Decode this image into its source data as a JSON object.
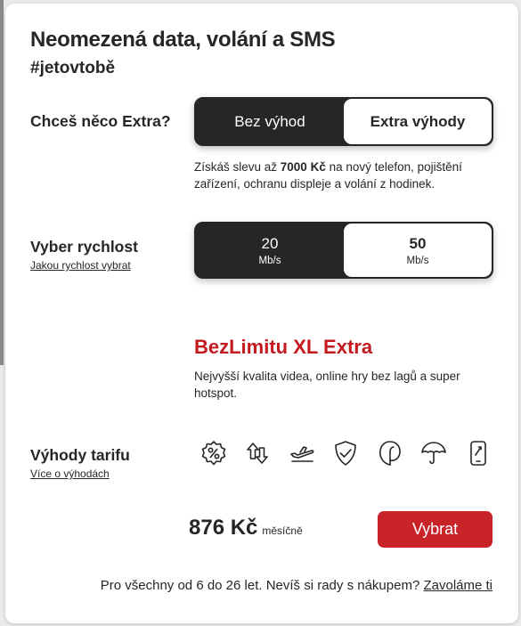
{
  "header": {
    "title": "Neomezená data, volání a SMS",
    "hashtag": "#jetovtobě"
  },
  "extra": {
    "label": "Chceš něco Extra?",
    "options": [
      "Bez výhod",
      "Extra výhody"
    ],
    "selected": "Extra výhody",
    "desc_before": "Získáš slevu až ",
    "desc_bold": "7000 Kč",
    "desc_after": " na nový telefon, pojištění zařízení, ochranu displeje a volání z hodinek."
  },
  "speed": {
    "label": "Vyber rychlost",
    "link": "Jakou rychlost vybrat",
    "options": [
      {
        "value": "20",
        "unit": "Mb/s"
      },
      {
        "value": "50",
        "unit": "Mb/s"
      }
    ],
    "selected": "50"
  },
  "plan": {
    "name": "BezLimitu XL Extra",
    "desc": "Nejvyšší kvalita videa, online hry bez lagů a super hotspot."
  },
  "benefits": {
    "label": "Výhody tarifu",
    "link": "Více o výhodách",
    "icons": [
      "discount-badge-icon",
      "data-transfer-icon",
      "airplane-roaming-icon",
      "shield-check-icon",
      "leaf-icon",
      "umbrella-icon",
      "phone-repair-icon"
    ]
  },
  "price": {
    "amount": "876 Kč",
    "period": "měsíčně"
  },
  "cta": {
    "label": "Vybrat"
  },
  "footer": {
    "text": "Pro všechny od 6 do 26 let. Nevíš si rady s nákupem? ",
    "link": "Zavoláme ti"
  },
  "colors": {
    "brand_red": "#c3191f",
    "button_red": "#c9232a",
    "dark": "#262626"
  }
}
